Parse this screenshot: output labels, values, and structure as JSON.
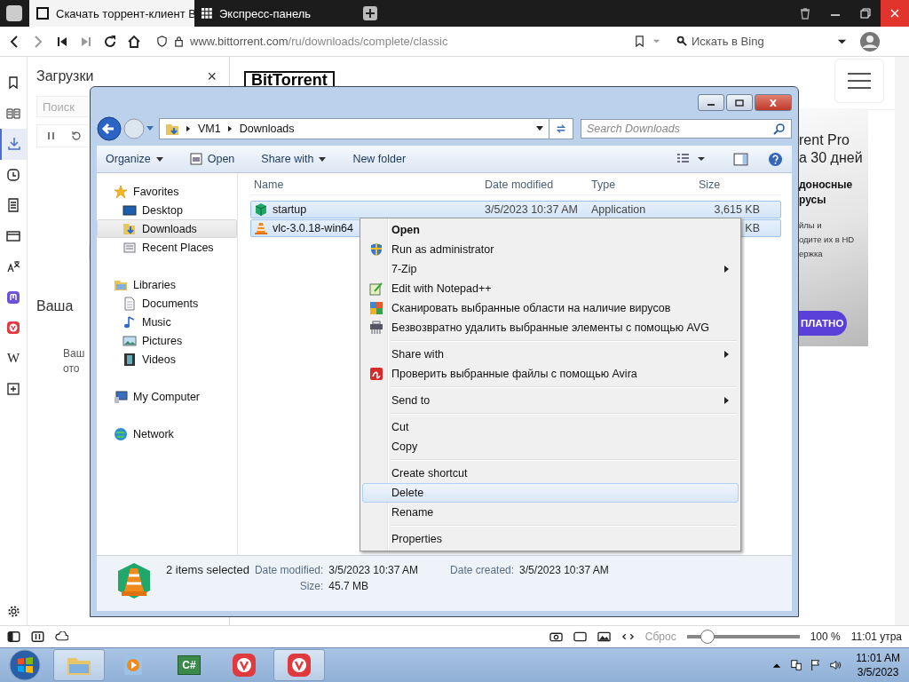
{
  "browser": {
    "tabs": [
      {
        "title": "Скачать торрент-клиент B",
        "selected": true
      },
      {
        "title": "Экспресс-панель",
        "selected": false
      }
    ],
    "address_host": "www.bittorrent.com",
    "address_path": "/ru/downloads/complete/classic",
    "search_placeholder": "Искать в Bing"
  },
  "side_panel": {
    "items": [
      {
        "kind": "bookmarks",
        "selected": false
      },
      {
        "kind": "reader",
        "selected": false
      },
      {
        "kind": "downloads",
        "selected": true
      },
      {
        "kind": "history",
        "selected": false
      },
      {
        "kind": "notes",
        "selected": false
      },
      {
        "kind": "window",
        "selected": false
      },
      {
        "kind": "translate",
        "selected": false
      },
      {
        "kind": "mastodon",
        "selected": false
      },
      {
        "kind": "vivaldi",
        "selected": false
      },
      {
        "kind": "letter",
        "label": "W",
        "selected": false
      },
      {
        "kind": "add",
        "selected": false
      }
    ]
  },
  "downloads_panel": {
    "title": "Загрузки",
    "close": "×",
    "search_placeholder": "Поиск",
    "heading": "Ваша",
    "text_lines": [
      "Ваш",
      "ото"
    ]
  },
  "page": {
    "logo": "BitTorrent",
    "promo": {
      "title_lines": [
        "rent Pro",
        "а 30 дней"
      ],
      "subtitle_lines": [
        "доносные",
        "русы"
      ],
      "body_lines": [
        "йлы и",
        "одите их в HD",
        "ержка"
      ],
      "button": "ПЛАТНО"
    }
  },
  "explorer": {
    "path": [
      "VM1",
      "Downloads"
    ],
    "search_placeholder": "Search Downloads",
    "toolbar": [
      {
        "label": "Organize",
        "dropdown": true
      },
      {
        "label": "Open",
        "dropdown": false
      },
      {
        "label": "Share with",
        "dropdown": true
      },
      {
        "label": "New folder",
        "dropdown": false
      }
    ],
    "nav": [
      {
        "kind": "favorites",
        "label": "Favorites",
        "selected": false,
        "children": [
          {
            "kind": "desktop",
            "label": "Desktop",
            "selected": false
          },
          {
            "kind": "downloads",
            "label": "Downloads",
            "selected": true
          },
          {
            "kind": "recent",
            "label": "Recent Places",
            "selected": false
          }
        ]
      },
      {
        "kind": "libraries",
        "label": "Libraries",
        "selected": false,
        "children": [
          {
            "kind": "documents",
            "label": "Documents",
            "selected": false
          },
          {
            "kind": "music",
            "label": "Music",
            "selected": false
          },
          {
            "kind": "pictures",
            "label": "Pictures",
            "selected": false
          },
          {
            "kind": "videos",
            "label": "Videos",
            "selected": false
          }
        ]
      },
      {
        "kind": "computer",
        "label": "My Computer",
        "selected": false
      },
      {
        "kind": "network",
        "label": "Network",
        "selected": false
      }
    ],
    "columns": [
      "Name",
      "Date modified",
      "Type",
      "Size"
    ],
    "files": [
      {
        "kind": "app",
        "name": "startup",
        "date": "3/5/2023 10:37 AM",
        "type": "Application",
        "size": "3,615 KB",
        "selected": true
      },
      {
        "kind": "vlc",
        "name": "vlc-3.0.18-win64",
        "size": "KB",
        "selected": true
      }
    ],
    "details": {
      "summary": "2 items selected",
      "fields": [
        {
          "label": "Date modified:",
          "value": "3/5/2023 10:37 AM"
        },
        {
          "label": "Date created:",
          "value": "3/5/2023 10:37 AM"
        },
        {
          "label": "Size:",
          "value": "45.7 MB"
        }
      ]
    }
  },
  "context_menu": {
    "items": [
      {
        "kind": "item",
        "label": "Open",
        "default": true,
        "submenu": false,
        "selected": false
      },
      {
        "kind": "item",
        "label": "Run as administrator",
        "default": false,
        "submenu": false,
        "selected": false
      },
      {
        "kind": "item",
        "label": "7-Zip",
        "default": false,
        "submenu": true,
        "selected": false
      },
      {
        "kind": "item",
        "label": "Edit with Notepad++",
        "default": false,
        "submenu": false,
        "selected": false
      },
      {
        "kind": "item",
        "label": "Сканировать выбранные области на наличие вирусов",
        "default": false,
        "submenu": false,
        "selected": false
      },
      {
        "kind": "item",
        "label": "Безвозвратно удалить выбранные элементы с помощью AVG",
        "default": false,
        "submenu": false,
        "selected": false
      },
      {
        "kind": "separator"
      },
      {
        "kind": "item",
        "label": "Share with",
        "default": false,
        "submenu": true,
        "selected": false
      },
      {
        "kind": "item",
        "label": "Проверить выбранные файлы с помощью Avira",
        "default": false,
        "submenu": false,
        "selected": false
      },
      {
        "kind": "separator"
      },
      {
        "kind": "item",
        "label": "Send to",
        "default": false,
        "submenu": true,
        "selected": false
      },
      {
        "kind": "separator"
      },
      {
        "kind": "item",
        "label": "Cut",
        "default": false,
        "submenu": false,
        "selected": false
      },
      {
        "kind": "item",
        "label": "Copy",
        "default": false,
        "submenu": false,
        "selected": false
      },
      {
        "kind": "separator"
      },
      {
        "kind": "item",
        "label": "Create shortcut",
        "default": false,
        "submenu": false,
        "selected": false
      },
      {
        "kind": "item",
        "label": "Delete",
        "default": false,
        "submenu": false,
        "selected": true
      },
      {
        "kind": "item",
        "label": "Rename",
        "default": false,
        "submenu": false,
        "selected": false
      },
      {
        "kind": "separator"
      },
      {
        "kind": "item",
        "label": "Properties",
        "default": false,
        "submenu": false,
        "selected": false
      }
    ]
  },
  "status_bar": {
    "reset": "Сброс",
    "zoom": {
      "level": 0.18
    },
    "zoom_text": "100 %",
    "time": "11:01 утра"
  },
  "taskbar": {
    "buttons": [
      {
        "kind": "explorer",
        "selected": true
      },
      {
        "kind": "media",
        "selected": false
      },
      {
        "kind": "csharp",
        "label": "C#",
        "selected": false
      },
      {
        "kind": "vivaldi",
        "selected": false
      },
      {
        "kind": "vivaldi",
        "selected": true
      }
    ],
    "time": "11:01 AM",
    "date": "3/5/2023"
  }
}
